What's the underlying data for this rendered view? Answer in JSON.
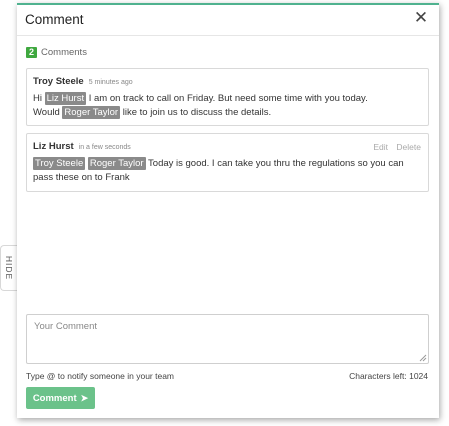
{
  "panel": {
    "title": "Comment",
    "close_icon": "close-icon",
    "hide_tab_label": "HIDE"
  },
  "summary": {
    "count": "2",
    "label": "Comments"
  },
  "comments": [
    {
      "author": "Troy Steele",
      "time": "5 minutes ago",
      "line1_prefix": "Hi",
      "line1_mention": "Liz Hurst",
      "line1_suffix": "I am on track to call on Friday. But need some time with you today.",
      "line2_prefix": "Would",
      "line2_mention": "Roger Taylor",
      "line2_suffix": "like to join us to discuss the details."
    },
    {
      "author": "Liz Hurst",
      "time": "in a few seconds",
      "edit_label": "Edit",
      "delete_label": "Delete",
      "mention1": "Troy Steele",
      "mention2": "Roger Taylor",
      "text": "Today is good. I can take you thru the regulations so you can pass these on to Frank"
    }
  ],
  "composer": {
    "placeholder": "Your Comment",
    "hint": "Type @ to notify someone in your team",
    "chars_left": "Characters left: 1024",
    "submit_label": "Comment",
    "submit_icon": "send-arrow-icon"
  },
  "colors": {
    "accent": "#4fb28f",
    "badge": "#3fa83f",
    "button": "#6bc28a",
    "mention_bg": "#8a8a8a"
  }
}
